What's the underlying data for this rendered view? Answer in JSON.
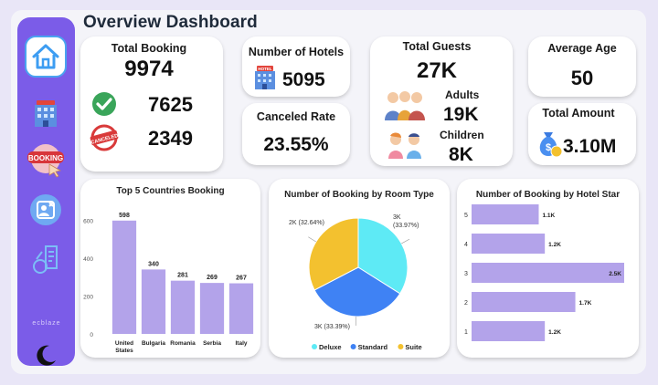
{
  "header": {
    "title": "Overview Dashboard"
  },
  "sidebar": {
    "items": [
      {
        "name": "home"
      },
      {
        "name": "hotel"
      },
      {
        "name": "booking",
        "label": "BOOKING"
      },
      {
        "name": "guest"
      },
      {
        "name": "finance"
      }
    ],
    "brand": "ecblaze"
  },
  "kpis": {
    "total_booking": {
      "label": "Total Booking",
      "value": "9974",
      "confirmed": "7625",
      "canceled": "2349",
      "canceled_stamp": "CANCELED"
    },
    "number_of_hotels": {
      "label": "Number of Hotels",
      "value": "5095",
      "sign": "HOTEL"
    },
    "canceled_rate": {
      "label": "Canceled Rate",
      "value": "23.55%"
    },
    "total_guests": {
      "label": "Total Guests",
      "value": "27K",
      "adults_label": "Adults",
      "adults": "19K",
      "children_label": "Children",
      "children": "8K"
    },
    "average_age": {
      "label": "Average Age",
      "value": "50"
    },
    "total_amount": {
      "label": "Total Amount",
      "value": "3.10M"
    }
  },
  "chart_data": [
    {
      "type": "bar",
      "title": "Top 5 Countries Booking",
      "categories": [
        "United States",
        "Bulgaria",
        "Romania",
        "Serbia",
        "Italy"
      ],
      "values": [
        598,
        340,
        281,
        269,
        267
      ],
      "ylim": [
        0,
        650
      ],
      "yticks": [
        0,
        200,
        400,
        600
      ],
      "color": "#b3a3ea"
    },
    {
      "type": "pie",
      "title": "Number of Booking by Room Type",
      "slices": [
        {
          "name": "Deluxe",
          "label": "3K (33.97%)",
          "value": 33.97,
          "color": "#5eeaf5"
        },
        {
          "name": "Standard",
          "label": "3K (33.39%)",
          "value": 33.39,
          "color": "#3f82f4"
        },
        {
          "name": "Suite",
          "label": "2K (32.64%)",
          "value": 32.64,
          "color": "#f3c12f"
        }
      ],
      "legend": [
        "Deluxe",
        "Standard",
        "Suite"
      ]
    },
    {
      "type": "bar",
      "title": "Number of Booking by Hotel Star",
      "orientation": "horizontal",
      "categories": [
        "5",
        "4",
        "3",
        "2",
        "1"
      ],
      "values": [
        1100,
        1200,
        2500,
        1700,
        1200
      ],
      "labels": [
        "1.1K",
        "1.2K",
        "2.5K",
        "1.7K",
        "1.2K"
      ],
      "color": "#b3a3ea"
    }
  ]
}
